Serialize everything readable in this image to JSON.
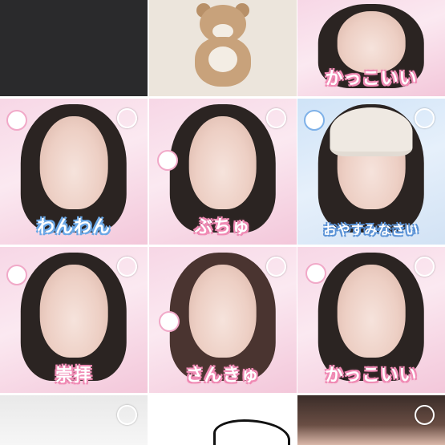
{
  "grid": {
    "tiles": [
      {
        "kind": "dark",
        "caption": "",
        "selectable": false
      },
      {
        "kind": "bear",
        "caption": "",
        "selectable": false
      },
      {
        "kind": "photo",
        "caption": "かっこいい",
        "selectable": false
      },
      {
        "kind": "photo",
        "caption": "わんわん",
        "selectable": true
      },
      {
        "kind": "photo",
        "caption": "ぶちゅ",
        "selectable": true
      },
      {
        "kind": "blue",
        "caption": "おやすみなさい",
        "selectable": true
      },
      {
        "kind": "photo",
        "caption": "崇拝",
        "selectable": true
      },
      {
        "kind": "photo",
        "caption": "さんきゅ",
        "selectable": true
      },
      {
        "kind": "photo",
        "caption": "かっこいい",
        "selectable": true
      },
      {
        "kind": "white",
        "caption": "",
        "selectable": true
      },
      {
        "kind": "white",
        "caption": "",
        "selectable": false
      },
      {
        "kind": "photo",
        "caption": "",
        "selectable": true
      }
    ]
  },
  "colors": {
    "caption_outline_pink": "#f08ab4",
    "caption_outline_blue": "#5a92d6",
    "background": "#ffffff"
  }
}
